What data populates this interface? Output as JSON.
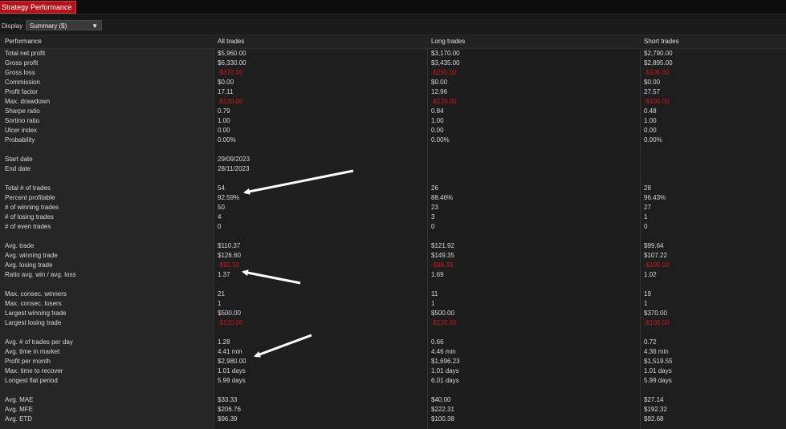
{
  "window": {
    "tab_title": "Strategy Performance"
  },
  "toolbar": {
    "display_label": "Display",
    "display_value": "Summary ($)"
  },
  "columns": [
    "Performance",
    "All trades",
    "Long trades",
    "Short trades"
  ],
  "rows": [
    {
      "label": "Total net profit",
      "all": "$5,960.00",
      "long": "$3,170.00",
      "short": "$2,790.00"
    },
    {
      "label": "Gross profit",
      "all": "$6,330.00",
      "long": "$3,435.00",
      "short": "$2,895.00"
    },
    {
      "label": "Gross loss",
      "all": "-$370.00",
      "long": "-$265.00",
      "short": "-$105.00",
      "neg": true
    },
    {
      "label": "Commission",
      "all": "$0.00",
      "long": "$0.00",
      "short": "$0.00"
    },
    {
      "label": "Profit factor",
      "all": "17.11",
      "long": "12.96",
      "short": "27.57"
    },
    {
      "label": "Max. drawdown",
      "all": "-$120.00",
      "long": "-$120.00",
      "short": "-$105.00",
      "neg": true
    },
    {
      "label": "Sharpe ratio",
      "all": "0.79",
      "long": "0.84",
      "short": "0.48"
    },
    {
      "label": "Sortino ratio",
      "all": "1.00",
      "long": "1.00",
      "short": "1.00"
    },
    {
      "label": "Ulcer index",
      "all": "0.00",
      "long": "0.00",
      "short": "0.00"
    },
    {
      "label": "Probability",
      "all": "0.00%",
      "long": "0.00%",
      "short": "0.00%"
    },
    {
      "label": "",
      "all": "",
      "long": "",
      "short": ""
    },
    {
      "label": "Start date",
      "all": "29/09/2023",
      "long": "",
      "short": ""
    },
    {
      "label": "End date",
      "all": "28/11/2023",
      "long": "",
      "short": ""
    },
    {
      "label": "",
      "all": "",
      "long": "",
      "short": ""
    },
    {
      "label": "Total # of trades",
      "all": "54",
      "long": "26",
      "short": "28"
    },
    {
      "label": "Percent profitable",
      "all": "92.59%",
      "long": "88.46%",
      "short": "96.43%"
    },
    {
      "label": "# of winning trades",
      "all": "50",
      "long": "23",
      "short": "27"
    },
    {
      "label": "# of losing trades",
      "all": "4",
      "long": "3",
      "short": "1"
    },
    {
      "label": "# of even trades",
      "all": "0",
      "long": "0",
      "short": "0"
    },
    {
      "label": "",
      "all": "",
      "long": "",
      "short": ""
    },
    {
      "label": "Avg. trade",
      "all": "$110.37",
      "long": "$121.92",
      "short": "$99.64"
    },
    {
      "label": "Avg. winning trade",
      "all": "$126.60",
      "long": "$149.35",
      "short": "$107.22"
    },
    {
      "label": "Avg. losing trade",
      "all": "-$92.50",
      "long": "-$88.33",
      "short": "-$105.00",
      "neg": true
    },
    {
      "label": "Ratio avg. win / avg. loss",
      "all": "1.37",
      "long": "1.69",
      "short": "1.02"
    },
    {
      "label": "",
      "all": "",
      "long": "",
      "short": ""
    },
    {
      "label": "Max. consec. winners",
      "all": "21",
      "long": "11",
      "short": "19"
    },
    {
      "label": "Max. consec. losers",
      "all": "1",
      "long": "1",
      "short": "1"
    },
    {
      "label": "Largest winning trade",
      "all": "$500.00",
      "long": "$500.00",
      "short": "$370.00"
    },
    {
      "label": "Largest losing trade",
      "all": "-$120.00",
      "long": "-$120.00",
      "short": "-$105.00",
      "neg": true
    },
    {
      "label": "",
      "all": "",
      "long": "",
      "short": ""
    },
    {
      "label": "Avg. # of trades per day",
      "all": "1.28",
      "long": "0.66",
      "short": "0.72"
    },
    {
      "label": "Avg. time in market",
      "all": "4.41 min",
      "long": "4.46 min",
      "short": "4.36 min"
    },
    {
      "label": "Profit per month",
      "all": "$2,980.00",
      "long": "$1,696.23",
      "short": "$1,519.55"
    },
    {
      "label": "Max. time to recover",
      "all": "1.01 days",
      "long": "1.01 days",
      "short": "1.01 days"
    },
    {
      "label": "Longest flat period",
      "all": "5.99 days",
      "long": "6.01 days",
      "short": "5.99 days"
    },
    {
      "label": "",
      "all": "",
      "long": "",
      "short": ""
    },
    {
      "label": "Avg. MAE",
      "all": "$33.33",
      "long": "$40.00",
      "short": "$27.14"
    },
    {
      "label": "Avg. MFE",
      "all": "$206.76",
      "long": "$222.31",
      "short": "$192.32"
    },
    {
      "label": "Avg. ETD",
      "all": "$96.39",
      "long": "$100.38",
      "short": "$92.68"
    }
  ],
  "colors": {
    "tab": "#b3141a",
    "negative": "#d0161d",
    "background": "#161616"
  },
  "icons": {
    "dropdown": "chevron-down-icon"
  }
}
